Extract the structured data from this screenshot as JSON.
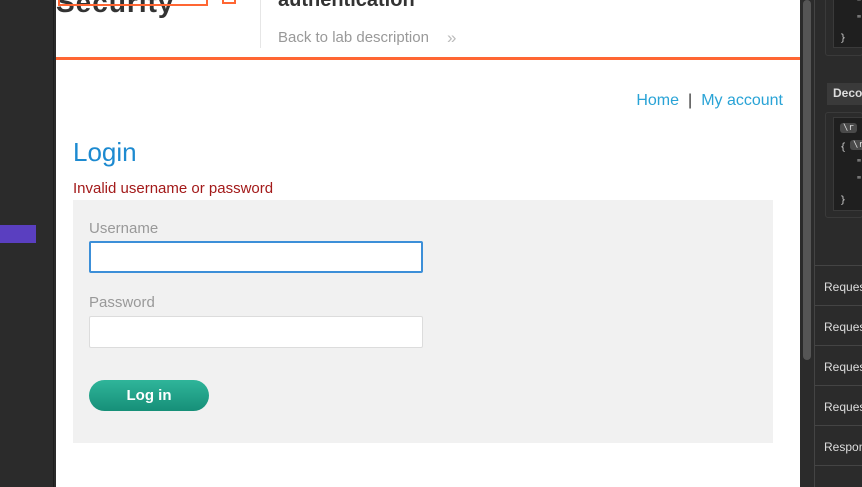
{
  "left_sidebar": {},
  "header": {
    "logo_text": "Security",
    "lab_title": "authentication",
    "back_link": "Back to lab description",
    "back_chevron": "»"
  },
  "nav": {
    "home": "Home",
    "separator": "|",
    "my_account": "My account"
  },
  "login": {
    "heading": "Login",
    "error": "Invalid username or password",
    "username_label": "Username",
    "username_value": "",
    "password_label": "Password",
    "password_value": "",
    "submit_label": "Log in"
  },
  "inspector": {
    "top_code": {
      "lines": [
        "\"",
        "\"",
        "}"
      ]
    },
    "decoded_header": "Decoded",
    "decoded_code": {
      "chip1": "\\r",
      "brace_open": "{",
      "chip2": "\\r",
      "quote1": "\"",
      "quote2": "\"",
      "brace_close": "}"
    },
    "request_items": [
      "Request",
      "Request",
      "Request",
      "Request",
      "Response"
    ]
  },
  "colors": {
    "accent_orange": "#ff6633",
    "link_blue": "#29a3d6",
    "heading_blue": "#1d8ad0",
    "error_red": "#a31a1a",
    "button_green": "#1fa589",
    "active_purple": "#5a3fc0"
  }
}
